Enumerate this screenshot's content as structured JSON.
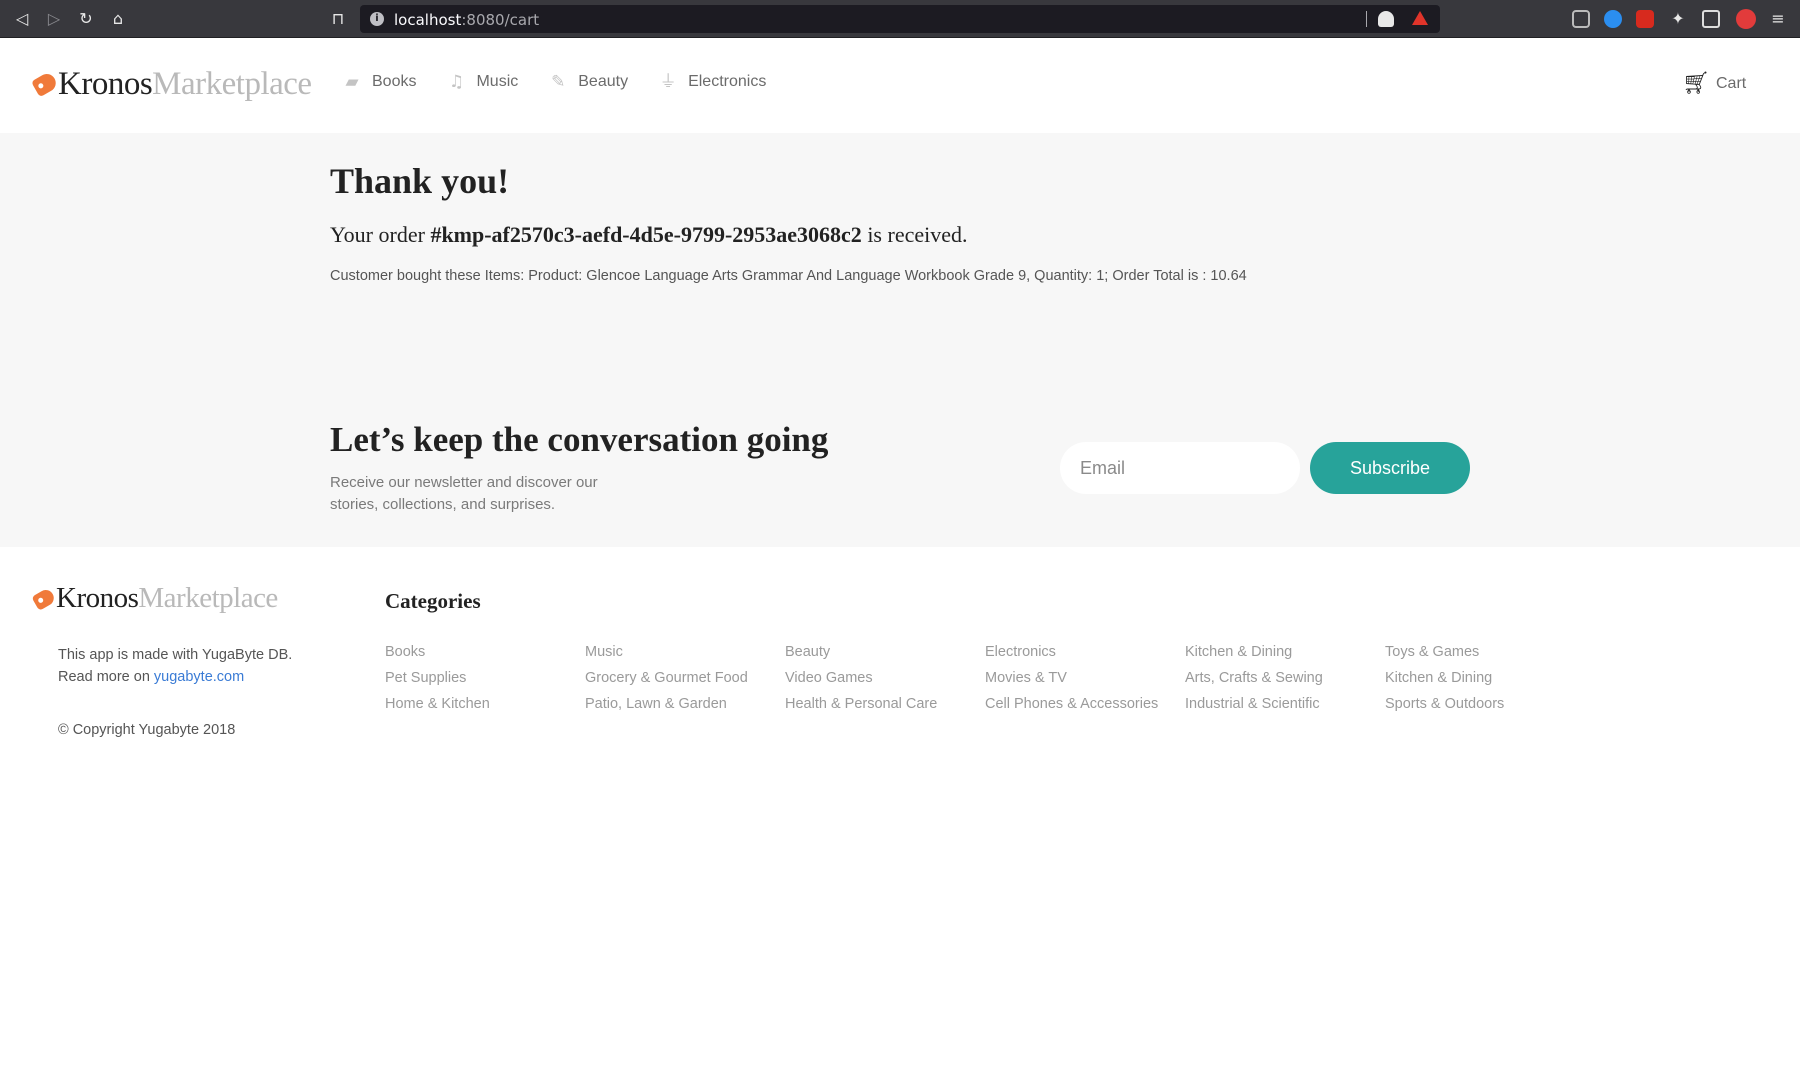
{
  "browser": {
    "url_host": "localhost",
    "url_rest": ":8080/cart"
  },
  "header": {
    "brand_primary": "Kronos",
    "brand_secondary": "Marketplace",
    "nav": [
      {
        "label": "Books",
        "icon": "book-icon"
      },
      {
        "label": "Music",
        "icon": "music-note-icon"
      },
      {
        "label": "Beauty",
        "icon": "brush-icon"
      },
      {
        "label": "Electronics",
        "icon": "plug-icon"
      }
    ],
    "cart_label": "Cart"
  },
  "order": {
    "title": "Thank you!",
    "line_prefix": "Your order",
    "order_id": "#kmp-af2570c3-aefd-4d5e-9799-2953ae3068c2",
    "line_suffix": "is received.",
    "items_text": "Customer bought these Items: Product: Glencoe Language Arts Grammar And Language Workbook Grade 9, Quantity: 1; Order Total is : 10.64"
  },
  "newsletter": {
    "title": "Let’s keep the conversation going",
    "description": "Receive our newsletter and discover our stories, collections, and surprises.",
    "email_placeholder": "Email",
    "subscribe_label": "Subscribe",
    "accent_color": "#27a39a"
  },
  "footer": {
    "brand_primary": "Kronos",
    "brand_secondary": "Marketplace",
    "about_text": "This app is made with YugaByte DB.",
    "read_more_prefix": "Read more on",
    "read_more_link": "yugabyte.com",
    "copyright": "© Copyright Yugabyte 2018",
    "categories_title": "Categories",
    "categories": [
      "Books",
      "Music",
      "Beauty",
      "Electronics",
      "Kitchen & Dining",
      "Toys & Games",
      "Pet Supplies",
      "Grocery & Gourmet Food",
      "Video Games",
      "Movies & TV",
      "Arts, Crafts & Sewing",
      "Kitchen & Dining",
      "Home & Kitchen",
      "Patio, Lawn & Garden",
      "Health & Personal Care",
      "Cell Phones & Accessories",
      "Industrial & Scientific",
      "Sports & Outdoors"
    ]
  }
}
